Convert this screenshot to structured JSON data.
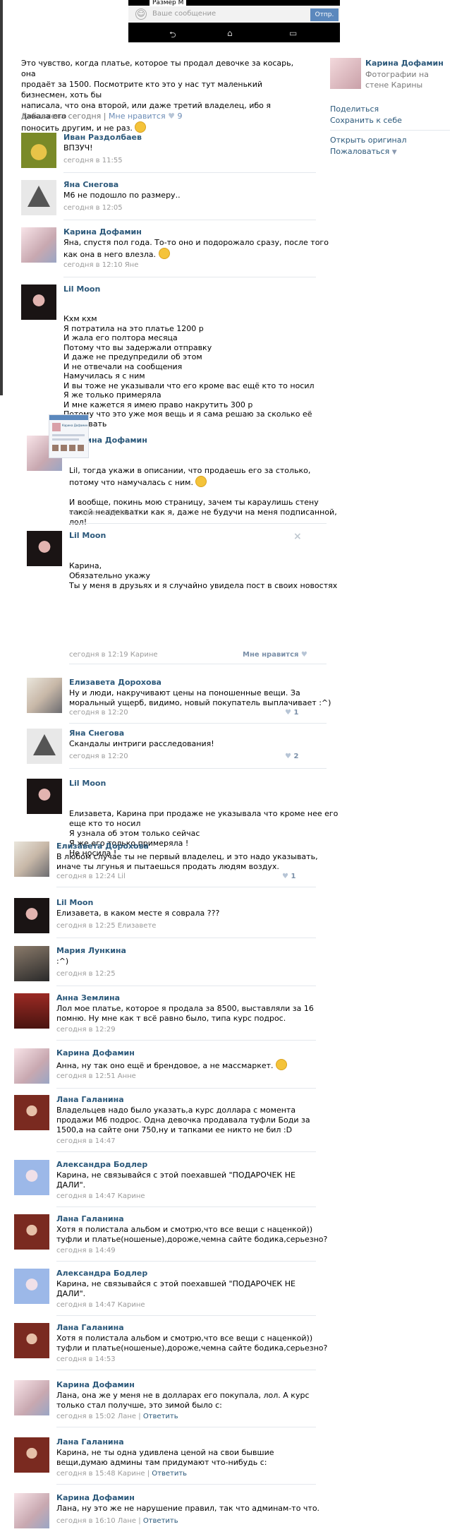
{
  "phone": {
    "subtitle": "Размер М",
    "input_placeholder": "Ваше сообщение",
    "send_label": "Отпр.",
    "nav_back": "⮌",
    "nav_home": "⌂",
    "nav_recent": "▭"
  },
  "post": {
    "text_lines": [
      "Это чувство, когда платье, которое ты продал девочке за косарь, она",
      "продаёт за 1500. Посмотрите кто это у нас тут маленький бизнесмен, хоть бы",
      "написала, что она второй, или даже третий владелец, ибо я давала его",
      "поносить другим, и не раз."
    ],
    "date": "Добавлена сегодня",
    "like_label": "Мне нравится",
    "like_count": "9"
  },
  "sidebar": {
    "owner_name": "Карина Дофамин",
    "owner_sub": "Фотографии на стене Карины",
    "share": "Поделиться",
    "save": "Сохранить к себе",
    "open_original": "Открыть оригинал",
    "report": "Пожаловаться"
  },
  "comments": [
    {
      "name": "Иван Раздолбаев",
      "lines": [
        "ВПЗУЧ!"
      ],
      "date": "сегодня в 11:55"
    },
    {
      "name": "Яна Снегова",
      "lines": [
        "М6 не подошло по размеру.."
      ],
      "date": "сегодня в 12:05"
    },
    {
      "name": "Карина Дофамин",
      "lines": [
        "Яна, спустя пол года. То-то оно и подорожало сразу, после того",
        "как она в него влезла."
      ],
      "date": "сегодня в 12:10 Яне"
    },
    {
      "name": "Lil Moon",
      "lines": [
        "Кхм кхм",
        "Я потратила на это платье 1200 р",
        "И жала его полтора месяца",
        "Потому что вы задержали отправку",
        "И даже не предупредили об этом",
        "И не отвечали на сообщения",
        "Намучилась я с ним",
        "И вы тоже не указывали что его кроме вас ещё кто то носил",
        "Я же только примеряла",
        "И мне кажется я имею право накрутить 300 р",
        "Потому что это уже моя вещь и я сама решаю за сколько её",
        "продавать"
      ]
    },
    {
      "name": "Карина Дофамин",
      "lines": [
        "Lil, тогда укажи в описании, что продаешь его за столько,",
        "потому что намучалась с ним.",
        "",
        "И вообще, покинь мою страницу, зачем ты караулишь стену",
        "такой неадекватки как я, даже не будучи на меня подписанной,",
        "лол!"
      ],
      "date": "сегодня в 12:16 Lil"
    },
    {
      "name": "Lil Moon",
      "lines": [
        "Карина,",
        "Обязательно укажу",
        "Ты у меня в друзьях и я случайно увидела пост в своих новостях"
      ],
      "date": "сегодня в 12:19 Карине",
      "like_label": "Мне нравится",
      "close": "×",
      "shot_title": "Карина Дофамин"
    },
    {
      "name": "Елизавета Дорохова",
      "lines": [
        "Ну и люди, накручивают цены на поношенные вещи. За",
        "моральный ущерб, видимо, новый покупатель выплачивает :^)"
      ],
      "date": "сегодня в 12:20",
      "likes": "1"
    },
    {
      "name": "Яна Снегова",
      "lines": [
        "Скандалы интриги расследования!"
      ],
      "date": "сегодня в 12:20",
      "likes": "2"
    },
    {
      "name": "Lil Moon",
      "lines": [
        "Елизавета, Карина при продаже не указывала что кроме нее его",
        "еще кто то носил",
        "Я узнала об этом только сейчас",
        "Я же его только примеряла !",
        "Не носила !"
      ]
    },
    {
      "name": "Елизавета Дорохова",
      "lines": [
        "В любом случае ты не первый владелец, и это надо указывать,",
        "иначе ты лгунья и пытаешься продать людям воздух."
      ],
      "date": "сегодня в 12:24 Lil",
      "likes": "1"
    },
    {
      "name": "Lil Moon",
      "lines": [
        "Елизавета, в каком месте я соврала ???"
      ],
      "date": "сегодня в 12:25 Елизавете"
    },
    {
      "name": "Мария Лункина",
      "lines": [
        ":^)"
      ],
      "date": "сегодня в 12:25"
    },
    {
      "name": "Анна Землина",
      "lines": [
        "Лол мое платье, которое я продала за 8500, выставляли за 16",
        "помню. Ну мне как т всё равно было, типа курс подрос."
      ],
      "date": "сегодня в 12:29"
    },
    {
      "name": "Карина Дофамин",
      "lines": [
        "Анна, ну так оно ещё и брендовое, а не массмаркет."
      ],
      "date": "сегодня в 12:51 Анне"
    },
    {
      "name": "Лана Галанина",
      "lines": [
        "Владельцев надо было указать,а курс доллара с момента",
        "продажи М6 подрос. Одна девочка продавала туфли Боди за",
        "1500,а на сайте они 750,ну и тапками ее никто не бил :D"
      ],
      "date": "сегодня в 14:47"
    },
    {
      "name": "Александра Бодлер",
      "lines": [
        "Карина, не связывайся с этой поехавшей \"ПОДАРОЧЕК НЕ",
        "ДАЛИ\"."
      ],
      "date": "сегодня в 14:47 Карине"
    },
    {
      "name": "Лана Галанина",
      "lines": [
        "Хотя я полистала альбом и смотрю,что все вещи с наценкой))",
        "туфли и платье(ношеные),дороже,чемна сайте бодика,серьезно?"
      ],
      "date": "сегодня в 14:49"
    },
    {
      "name": "Александра Бодлер",
      "lines": [
        "Карина, не связывайся с этой поехавшей \"ПОДАРОЧЕК НЕ",
        "ДАЛИ\"."
      ],
      "date": "сегодня в 14:47 Карине"
    },
    {
      "name": "Лана Галанина",
      "lines": [
        "Хотя я полистала альбом и смотрю,что все вещи с наценкой))",
        "туфли и платье(ношеные),дороже,чемна сайте бодика,серьезно?"
      ],
      "date": "сегодня в 14:53"
    },
    {
      "name": "Карина Дофамин",
      "lines": [
        "Лана, она же у меня не в долларах его покупала, лол. А курс",
        "только стал получше, это зимой было с:"
      ],
      "date": "сегодня в 15:02 Лане",
      "reply": "Ответить"
    },
    {
      "name": "Лана Галанина",
      "lines": [
        "Карина, не ты одна удивлена ценой на свои бывшие",
        "вещи,думаю админы там придумают что-нибудь с:"
      ],
      "date": "сегодня в 15:48 Карине",
      "reply": "Ответить"
    },
    {
      "name": "Карина Дофамин",
      "lines": [
        "Лана, ну это же не нарушение правил, так что админам-то что."
      ],
      "date": "сегодня в 16:10 Лане",
      "reply": "Ответить"
    }
  ]
}
